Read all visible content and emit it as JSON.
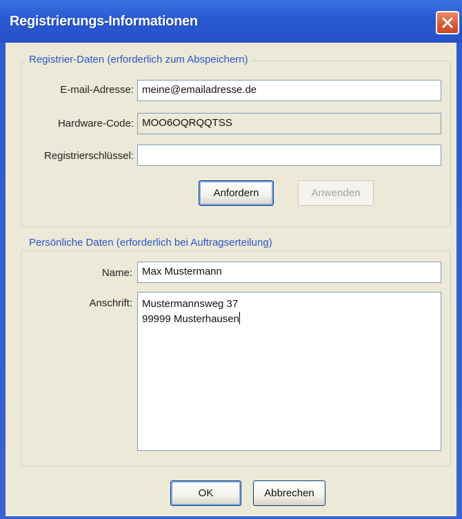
{
  "window": {
    "title": "Registrierungs-Informationen"
  },
  "registration": {
    "legend": "Registrier-Daten (erforderlich zum Abspeichern)",
    "email_label": "E-mail-Adresse:",
    "email_value": "meine@emailadresse.de",
    "hardware_label": "Hardware-Code:",
    "hardware_value": "MOO6OQRQQTSS",
    "key_label": "Registrierschlüssel:",
    "key_value": "",
    "request_button": "Anfordern",
    "apply_button": "Anwenden"
  },
  "personal": {
    "legend": "Persönliche Daten (erforderlich bei Auftragserteilung)",
    "name_label": "Name:",
    "name_value": "Max Mustermann",
    "address_label": "Anschrift:",
    "address_line1": "Mustermannsweg 37",
    "address_line2": "99999 Musterhausen"
  },
  "footer": {
    "ok_button": "OK",
    "cancel_button": "Abbrechen"
  },
  "icons": {
    "close": "close-icon"
  }
}
